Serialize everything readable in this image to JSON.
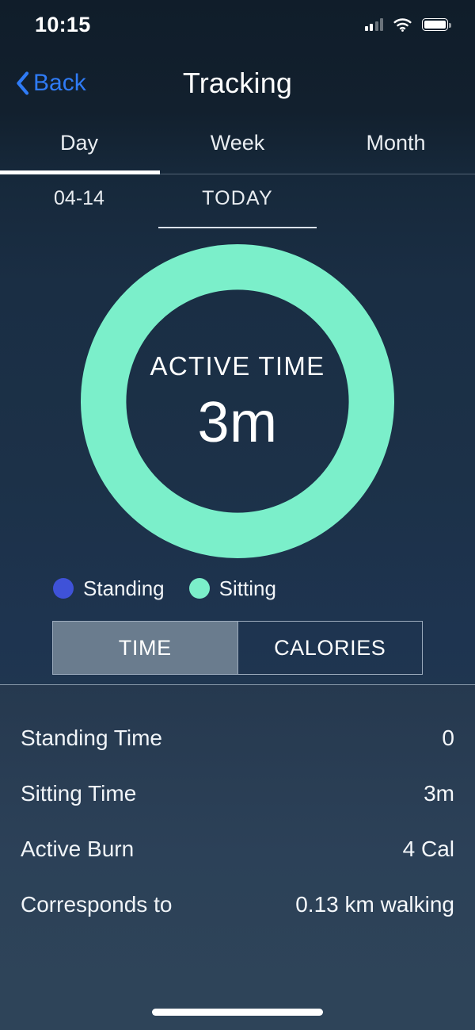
{
  "status_bar": {
    "time": "10:15",
    "signal_icon": "cellular-signal-icon",
    "wifi_icon": "wifi-icon",
    "battery_icon": "battery-full-icon"
  },
  "nav": {
    "back_label": "Back",
    "back_icon": "chevron-left-icon",
    "title": "Tracking"
  },
  "period_tabs": {
    "items": [
      {
        "label": "Day",
        "active": true
      },
      {
        "label": "Week",
        "active": false
      },
      {
        "label": "Month",
        "active": false
      }
    ]
  },
  "date_selector": {
    "items": [
      {
        "label": "04-14",
        "active": false
      },
      {
        "label": "TODAY",
        "active": true
      },
      {
        "label": "",
        "active": false
      }
    ]
  },
  "donut": {
    "center_label": "ACTIVE TIME",
    "center_value": "3m"
  },
  "legend": {
    "items": [
      {
        "label": "Standing",
        "color": "#3F52D8"
      },
      {
        "label": "Sitting",
        "color": "#7BEFCA"
      }
    ]
  },
  "segmented_control": {
    "options": [
      {
        "label": "TIME",
        "selected": true
      },
      {
        "label": "CALORIES",
        "selected": false
      }
    ]
  },
  "stats": {
    "rows": [
      {
        "label": "Standing Time",
        "value": "0"
      },
      {
        "label": "Sitting Time",
        "value": "3m"
      },
      {
        "label": "Active Burn",
        "value": "4 Cal"
      },
      {
        "label": "Corresponds to",
        "value": "0.13 km walking"
      }
    ]
  },
  "colors": {
    "accent_green": "#7BEFCA",
    "accent_blue": "#3F52D8",
    "link_blue": "#2F7BF6",
    "bg_top": "#101D2A",
    "bg_mid": "#1C3148",
    "bg_panel": "#2C4158",
    "segment_selected": "#6A7C8E"
  },
  "chart_data": {
    "type": "pie",
    "title": "ACTIVE TIME",
    "center_value": "3m",
    "categories": [
      "Standing",
      "Sitting"
    ],
    "values": [
      0,
      3
    ],
    "value_labels": [
      "0",
      "3m"
    ],
    "colors": [
      "#3F52D8",
      "#7BEFCA"
    ],
    "units": "minutes",
    "legend_position": "bottom-left",
    "donut": true,
    "donut_hole_ratio": 0.72
  }
}
